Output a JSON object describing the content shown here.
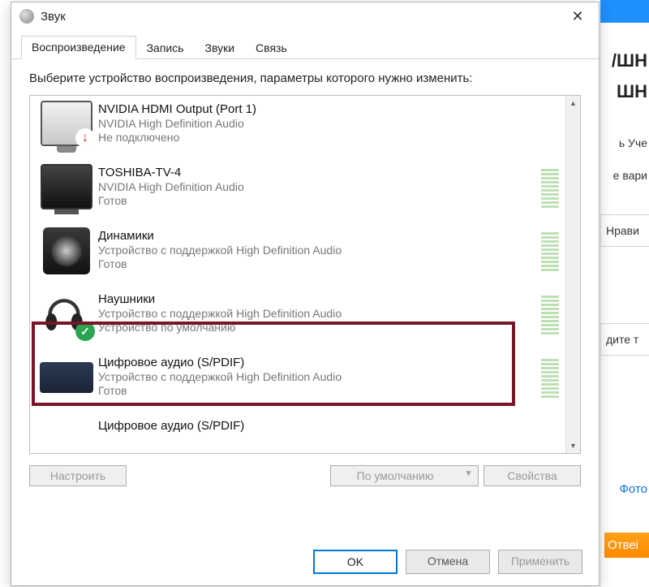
{
  "dialog": {
    "title": "Звук",
    "close_glyph": "✕",
    "tabs": [
      "Воспроизведение",
      "Запись",
      "Звуки",
      "Связь"
    ],
    "active_tab_index": 0,
    "instruction": "Выберите устройство воспроизведения, параметры которого нужно изменить:",
    "devices": [
      {
        "name": "NVIDIA HDMI Output (Port 1)",
        "desc": "NVIDIA High Definition Audio",
        "status": "Не подключено",
        "icon": "monitor",
        "overlay": "red",
        "meter": false
      },
      {
        "name": "TOSHIBA-TV-4",
        "desc": "NVIDIA High Definition Audio",
        "status": "Готов",
        "icon": "tv",
        "overlay": "",
        "meter": true
      },
      {
        "name": "Динамики",
        "desc": "Устройство с поддержкой High Definition Audio",
        "status": "Готов",
        "icon": "speaker",
        "overlay": "",
        "meter": true
      },
      {
        "name": "Наушники",
        "desc": "Устройство с поддержкой High Definition Audio",
        "status": "Устройство по умолчанию",
        "icon": "hp",
        "overlay": "green",
        "meter": true
      },
      {
        "name": "Цифровое аудио (S/PDIF)",
        "desc": "Устройство с поддержкой High Definition Audio",
        "status": "Готов",
        "icon": "spdif",
        "overlay": "",
        "meter": true
      },
      {
        "name": "Цифровое аудио (S/PDIF)",
        "desc": "",
        "status": "",
        "icon": "spdif",
        "overlay": "",
        "meter": false
      }
    ],
    "buttons": {
      "configure": "Настроить",
      "default": "По умолчанию",
      "properties": "Свойства",
      "ok": "OK",
      "cancel": "Отмена",
      "apply": "Применить"
    },
    "scroll": {
      "up": "▲",
      "down": "▼"
    },
    "dropdown_glyph": "▼"
  },
  "background": {
    "h1a": "/ШН",
    "h1b": "ШН",
    "t1": "ь Уче",
    "t2": "е вари",
    "box1": "Нрави",
    "box2": "дите т",
    "link": "Фото",
    "btn": "Отвеі"
  }
}
